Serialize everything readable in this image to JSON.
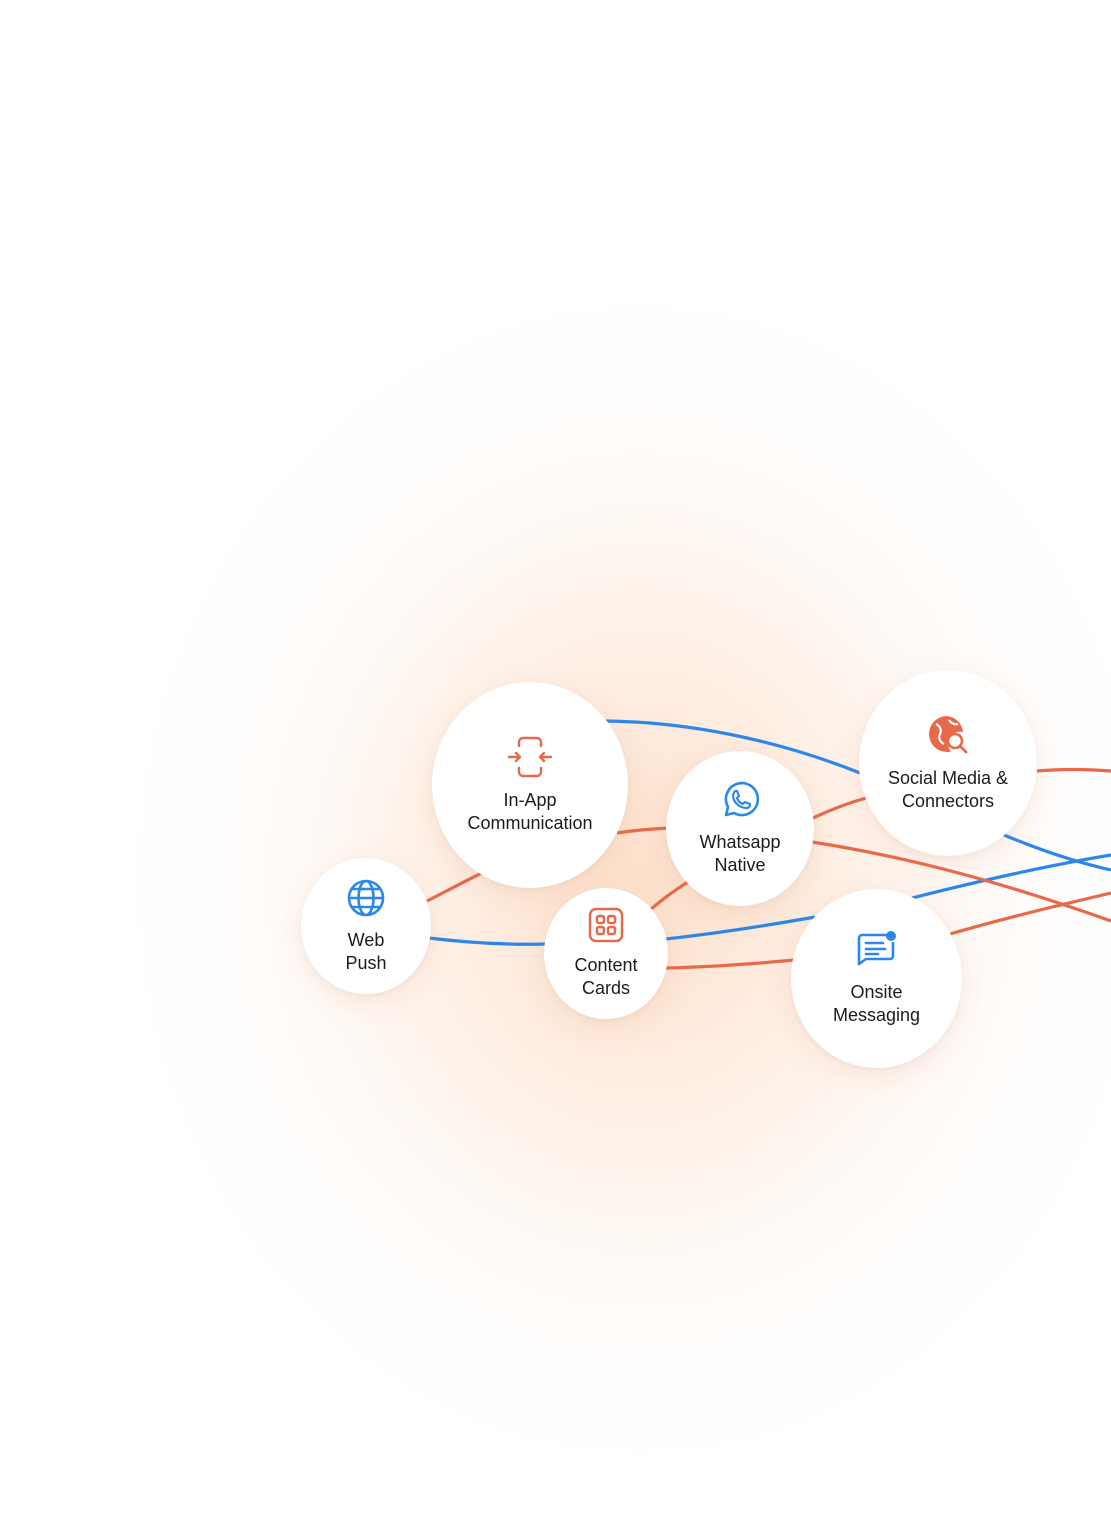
{
  "colors": {
    "orange": "#E8684A",
    "blue": "#2B87EA",
    "text": "#1C1C1C",
    "node_bg": "#FFFFFF"
  },
  "nodes": {
    "in_app": {
      "label": "In-App\nCommunication",
      "icon": "phone-compress-icon",
      "color": "#E8684A"
    },
    "whatsapp": {
      "label": "Whatsapp\nNative",
      "icon": "whatsapp-icon",
      "color": "#2B87EA"
    },
    "social": {
      "label": "Social Media &\nConnectors",
      "icon": "globe-search-icon",
      "color": "#E8684A"
    },
    "web_push": {
      "label": "Web\nPush",
      "icon": "globe-icon",
      "color": "#2B87EA"
    },
    "content_cards": {
      "label": "Content\nCards",
      "icon": "grid-icon",
      "color": "#E8684A"
    },
    "onsite": {
      "label": "Onsite\nMessaging",
      "icon": "message-notification-icon",
      "color": "#2B87EA"
    }
  }
}
